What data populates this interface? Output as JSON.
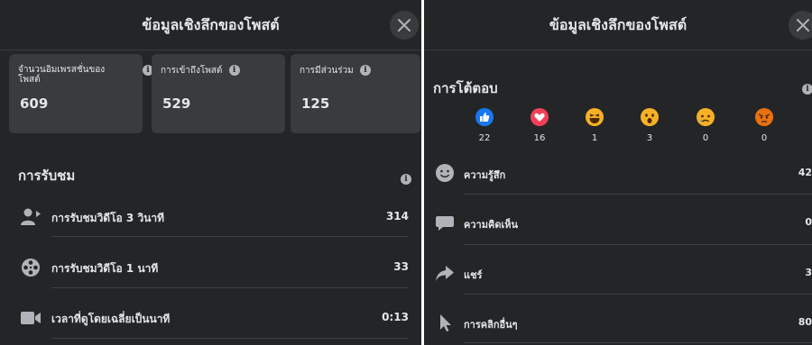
{
  "left": {
    "title": "ข้อมูลเชิงลึกของโพสต์",
    "stats": [
      {
        "label": "จำนวนอิมเพรสชั่นของโพสต์",
        "value": "609"
      },
      {
        "label": "การเข้าถึงโพสต์",
        "value": "529"
      },
      {
        "label": "การมีส่วนร่วม",
        "value": "125"
      }
    ],
    "views_title": "การรับชม",
    "rows": [
      {
        "label": "การรับชมวิดีโอ 3 วินาที",
        "value": "314",
        "icon": "viewers-icon"
      },
      {
        "label": "การรับชมวิดีโอ 1 นาที",
        "value": "33",
        "icon": "film-reel-icon"
      },
      {
        "label": "เวลาที่ดูโดยเฉลี่ยเป็นนาที",
        "value": "0:13",
        "icon": "video-camera-icon"
      }
    ]
  },
  "right": {
    "title": "ข้อมูลเชิงลึกของโพสต์",
    "reactions_title": "การโต้ตอบ",
    "reactions": [
      {
        "type": "like",
        "count": "22",
        "color": "#1877f2"
      },
      {
        "type": "love",
        "count": "16",
        "color": "#f33e58"
      },
      {
        "type": "haha",
        "count": "1",
        "color": "#f7b125"
      },
      {
        "type": "wow",
        "count": "3",
        "color": "#f7b125"
      },
      {
        "type": "sad",
        "count": "0",
        "color": "#f7b125"
      },
      {
        "type": "angry",
        "count": "0",
        "color": "#e9710f"
      }
    ],
    "rows": [
      {
        "label": "ความรู้สึก",
        "value": "42",
        "icon": "smiley-icon"
      },
      {
        "label": "ความคิดเห็น",
        "value": "0",
        "icon": "comment-icon"
      },
      {
        "label": "แชร์",
        "value": "3",
        "icon": "share-arrow-icon"
      },
      {
        "label": "การคลิกอื่นๆ",
        "value": "80",
        "icon": "cursor-icon"
      }
    ]
  },
  "colors": {
    "panel": "#242526",
    "card": "#3a3b3c",
    "text": "#e4e6eb",
    "icon": "#b0b3b8"
  }
}
